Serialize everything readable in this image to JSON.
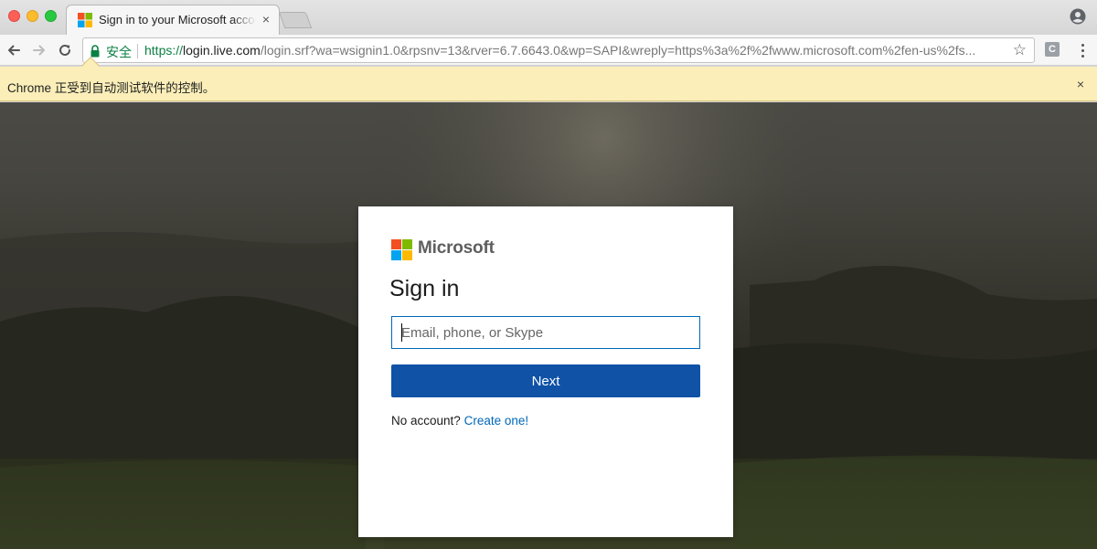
{
  "browser": {
    "tab": {
      "title": "Sign in to your Microsoft account",
      "close": "×"
    },
    "address": {
      "secure_label": "安全",
      "url_protocol": "https://",
      "url_host": "login.live.com",
      "url_rest": "/login.srf?wa=wsignin1.0&rpsnv=13&rver=6.7.6643.0&wp=SAPI&wreply=https%3a%2f%2fwww.microsoft.com%2fen-us%2fs..."
    },
    "star": "☆",
    "extension": "C",
    "infobar": {
      "text": "Chrome 正受到自动测试软件的控制。",
      "close": "×"
    }
  },
  "signin": {
    "brand": "Microsoft",
    "title": "Sign in",
    "email_placeholder": "Email, phone, or Skype",
    "next_label": "Next",
    "no_account_text": "No account?",
    "create_link": "Create one!"
  },
  "colors": {
    "ms_red": "#f25022",
    "ms_green": "#7fba00",
    "ms_blue": "#00a4ef",
    "ms_yellow": "#ffb900",
    "accent": "#0f52a6",
    "link": "#0067b8"
  },
  "icons": [
    "back-arrow-icon",
    "forward-arrow-icon",
    "reload-icon",
    "lock-icon",
    "star-icon",
    "profile-icon",
    "menu-dots-icon",
    "close-icon",
    "microsoft-logo-icon"
  ]
}
